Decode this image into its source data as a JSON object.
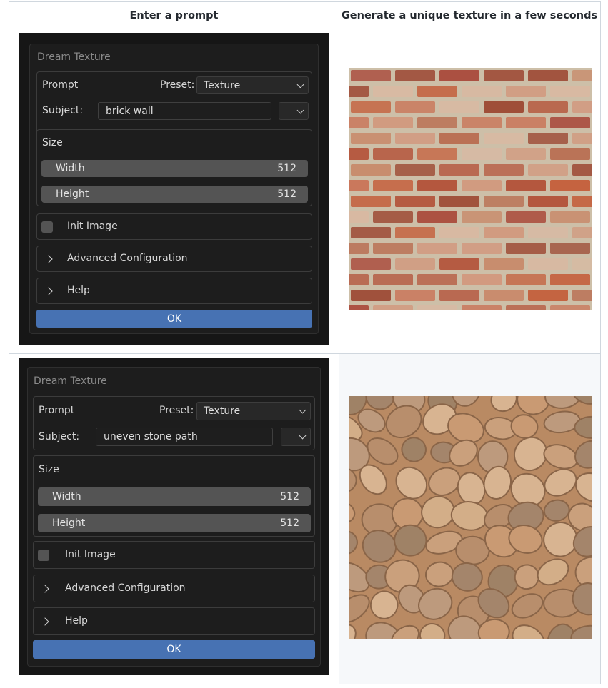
{
  "table": {
    "headers": [
      "Enter a prompt",
      "Generate a unique texture in a few seconds"
    ]
  },
  "rows": [
    {
      "dialog_title": "Dream Texture",
      "prompt_label": "Prompt",
      "preset_label": "Preset:",
      "preset_value": "Texture",
      "subject_label": "Subject:",
      "subject_value": "brick wall",
      "size_label": "Size",
      "width_label": "Width",
      "width_value": "512",
      "height_label": "Height",
      "height_value": "512",
      "init_image_label": "Init Image",
      "advanced_label": "Advanced Configuration",
      "help_label": "Help",
      "ok_label": "OK",
      "texture": "brick-wall"
    },
    {
      "dialog_title": "Dream Texture",
      "prompt_label": "Prompt",
      "preset_label": "Preset:",
      "preset_value": "Texture",
      "subject_label": "Subject:",
      "subject_value": "uneven stone path",
      "size_label": "Size",
      "width_label": "Width",
      "width_value": "512",
      "height_label": "Height",
      "height_value": "512",
      "init_image_label": "Init Image",
      "advanced_label": "Advanced Configuration",
      "help_label": "Help",
      "ok_label": "OK",
      "texture": "stone-path"
    }
  ],
  "colors": {
    "dialog_bg": "#161616",
    "field_bg": "#545454",
    "ok_button": "#4772b3",
    "table_border": "#d0d7de",
    "row_alt_bg": "#f6f8fa"
  },
  "icons": {
    "dropdown": "chevron-down-icon",
    "collapsed_section": "chevron-right-icon",
    "checkbox": "checkbox-icon"
  }
}
